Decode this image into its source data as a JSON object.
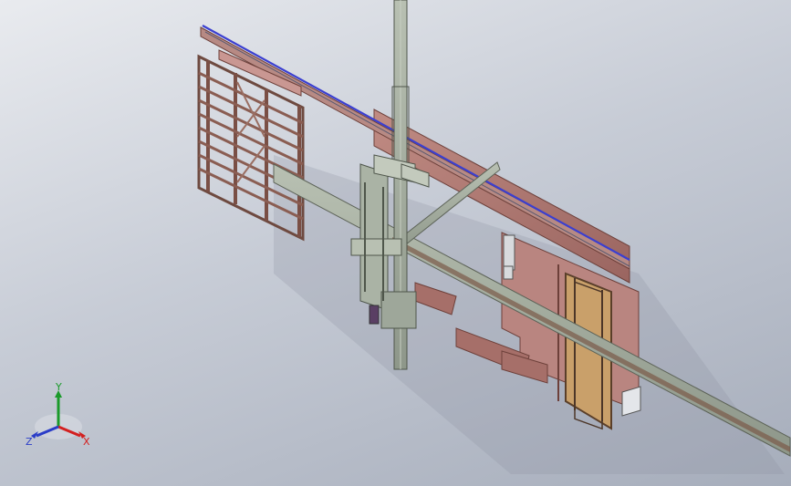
{
  "triad": {
    "x_label": "X",
    "y_label": "Y",
    "z_label": "Z",
    "x_color": "#d32020",
    "y_color": "#1a9a2a",
    "z_color": "#2a3cc8"
  },
  "colors": {
    "background_top": "#e9ebef",
    "background_bottom": "#a6adbb",
    "frame_brown": "#7a4f45",
    "panel_rose": "#b07a74",
    "beam_grey": "#9fa89a",
    "rail_blue": "#3b3fd0"
  }
}
